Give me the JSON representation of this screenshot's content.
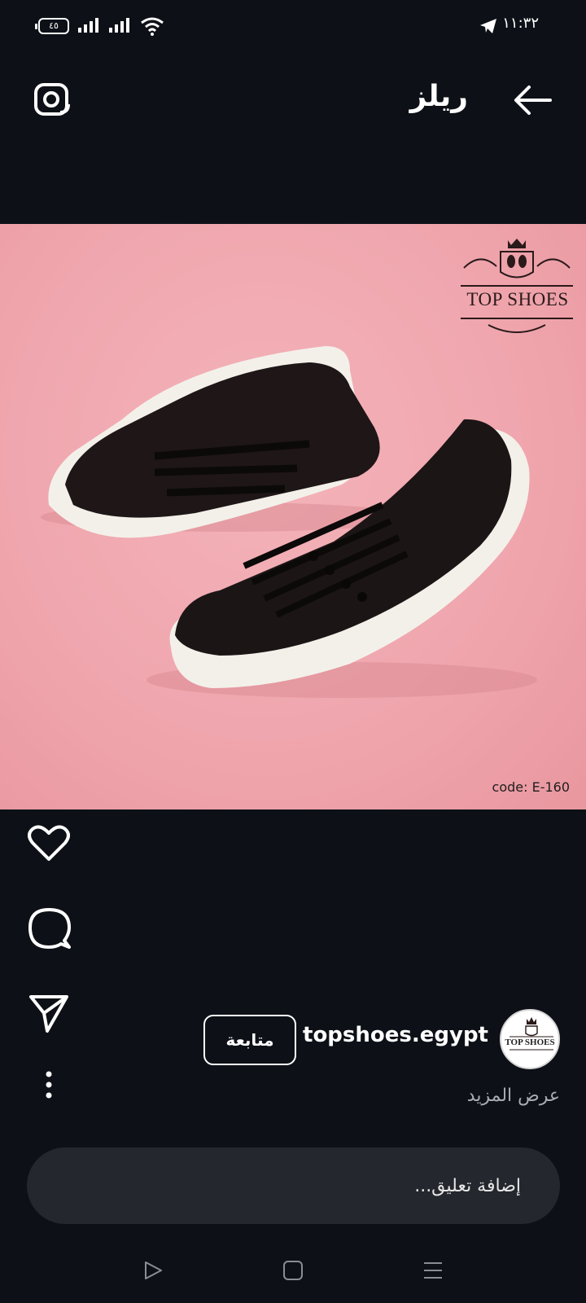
{
  "status_bar": {
    "time": "١١:٣٢",
    "battery": "٤٥",
    "icons": [
      "battery-icon",
      "signal-icon",
      "signal-icon",
      "wifi-icon",
      "telegram-icon"
    ]
  },
  "header": {
    "title": "ريلز",
    "back_icon": "arrow-right-icon",
    "camera_icon": "camera-icon"
  },
  "media": {
    "brand_logo_text": "TOP SHOES",
    "product_code": "code: E-160"
  },
  "actions": [
    {
      "name": "like",
      "icon": "heart-icon"
    },
    {
      "name": "comment",
      "icon": "comment-icon"
    },
    {
      "name": "share",
      "icon": "send-icon"
    },
    {
      "name": "more",
      "icon": "more-vertical-icon"
    }
  ],
  "author": {
    "username": "topshoes.egypt",
    "follow_label": "متابعة",
    "avatar_text": "TOP SHOES",
    "show_more": "عرض المزيد"
  },
  "comment": {
    "placeholder": "إضافة تعليق..."
  },
  "navigation": {
    "buttons": [
      "back-icon",
      "home-icon",
      "recents-icon"
    ]
  },
  "colors": {
    "background": "#0d1117",
    "media_background": "#f0a6ae",
    "input_background": "#24272d",
    "muted_text": "#a9adb3"
  }
}
